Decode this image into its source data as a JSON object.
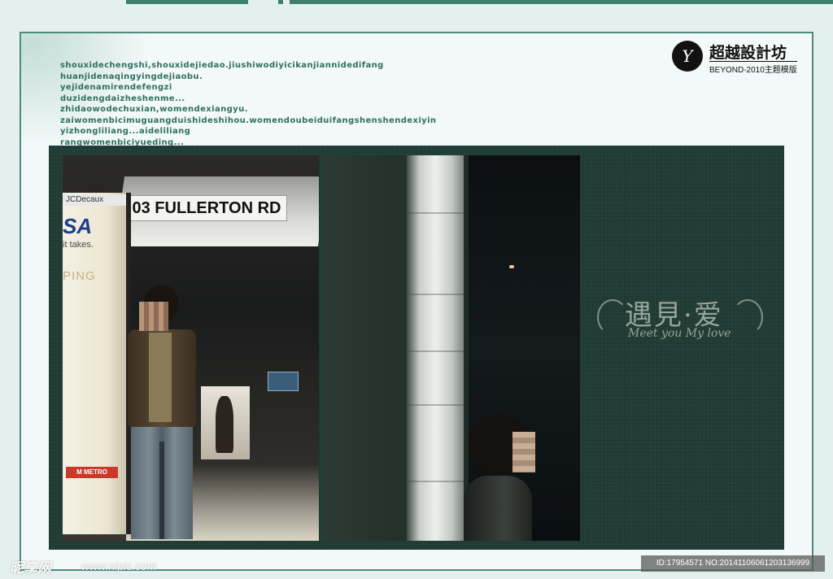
{
  "poem": {
    "lines": [
      "shouxidechengshi,shouxidejiedao.jiushiwodiyicikanjiannidedifang",
      "huanjidenaqingyingdejiaobu.",
      "yejidenamirendefengzi",
      "duzidengdaizheshenme...",
      "zhidaowodechuxian,womendexiangyu.",
      "zaiwomenbicimuguangduishideshihou.womendoubeiduifangshenshendexiyin",
      "yizhongliliang...aideliliang",
      "rangwomenbiciyueding..."
    ]
  },
  "brand": {
    "name": "超越設計坊",
    "subtitle": "BEYOND-2010主题模版"
  },
  "photo1": {
    "street_sign": "03 FULLERTON RD",
    "ad_brand": "JCDecaux",
    "ad_big": "SA",
    "ad_small": "it takes.",
    "ad_ping": "PING",
    "ad_metro": "M METRO"
  },
  "deco": {
    "title": "遇見·爱",
    "subtitle": "Meet you My love"
  },
  "watermark": {
    "site_logo": "昵享网",
    "url": "www.nipic.com",
    "id_text": "ID:17954571 NO:20141106061203136999"
  },
  "colors": {
    "accent": "#3f7f6f",
    "dark_panel": "#1f3b33",
    "page_bg": "#e3f0ee"
  }
}
